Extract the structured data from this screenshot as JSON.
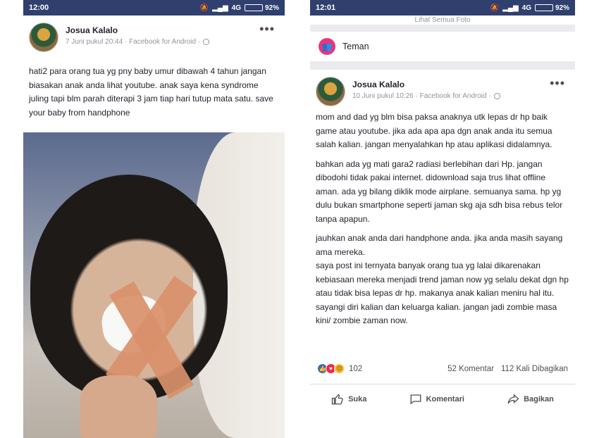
{
  "left": {
    "status": {
      "time": "12:00",
      "network": "4G",
      "battery": "92%",
      "battery_level": 0.92
    },
    "post": {
      "author": "Josua Kalalo",
      "timestamp": "7 Juni pukul 20:44 · Facebook for Android ·",
      "text": "hati2 para orang tua yg pny baby umur dibawah 4 tahun jangan biasakan anak anda lihat youtube. anak saya kena syndrome juling tapi blm parah diterapi 3 jam tiap hari tutup mata satu. save your baby from handphone",
      "more": "•••"
    }
  },
  "right": {
    "status": {
      "time": "12:01",
      "network": "4G",
      "battery": "92%",
      "battery_level": 0.92
    },
    "top_strip": "Lihat Semua Foto",
    "friends": {
      "label": "Teman"
    },
    "post": {
      "author": "Josua Kalalo",
      "timestamp": "10 Juni pukul 10:26 · Facebook for Android ·",
      "more": "•••",
      "paragraphs": [
        "mom and dad yg blm bisa paksa anaknya utk lepas dr hp baik game atau youtube. jika ada apa apa dgn anak anda itu semua salah kalian. jangan menyalahkan hp atau aplikasi didalamnya.",
        "bahkan ada yg mati gara2 radiasi berlebihan dari Hp. jangan dibodohi tidak pakai internet. didownload saja trus lihat offline aman. ada yg bilang diklik mode airplane. semuanya sama. hp yg dulu bukan smartphone seperti jaman skg aja sdh bisa rebus telor tanpa apapun.",
        "jauhkan anak anda dari handphone anda. jika anda masih sayang ama mereka.\nsaya post ini ternyata banyak orang tua yg lalai dikarenakan kebiasaan mereka menjadi trend jaman now yg selalu dekat dgn hp atau tidak bisa lepas dr hp. makanya anak kalian meniru hal itu. sayangi diri kalian dan keluarga kalian. jangan jadi zombie masa kini/ zombie zaman now."
      ],
      "reaction_count": "102",
      "comments": "52 Komentar",
      "shares": "112 Kali Dibagikan",
      "actions": {
        "like": "Suka",
        "comment": "Komentari",
        "share": "Bagikan"
      }
    }
  }
}
